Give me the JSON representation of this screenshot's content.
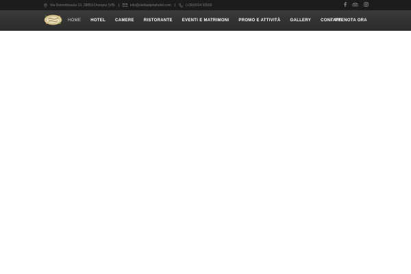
{
  "topbar": {
    "address": "Via Domodossola 13, 28853 Druogno (VB)",
    "email": "info@stellaalpinahotel.com",
    "phone": "(+39)0324 93593",
    "icons": {
      "address": "map-pin-icon",
      "email": "envelope-icon",
      "phone": "phone-icon"
    },
    "social": [
      "facebook-icon",
      "tripadvisor-icon",
      "instagram-icon"
    ]
  },
  "navbar": {
    "logo": "Stella Alpina",
    "menu": [
      {
        "label": "HOME",
        "active": true
      },
      {
        "label": "HOTEL",
        "active": false
      },
      {
        "label": "CAMERE",
        "active": false
      },
      {
        "label": "RISTORANTE",
        "active": false
      },
      {
        "label": "EVENTI E MATRIMONI",
        "active": false
      },
      {
        "label": "PROMO E ATTIVITÀ",
        "active": false
      },
      {
        "label": "GALLERY",
        "active": false
      },
      {
        "label": "CONTATTI",
        "active": false
      }
    ],
    "book_label": "PRENOTA ORA",
    "book_icon": "chevron-right-icon"
  },
  "colors": {
    "topbar_bg": "#1c1c1c",
    "navbar_bg": "#333333",
    "nav_text": "#ffffff",
    "content_bg": "#ffffff"
  }
}
